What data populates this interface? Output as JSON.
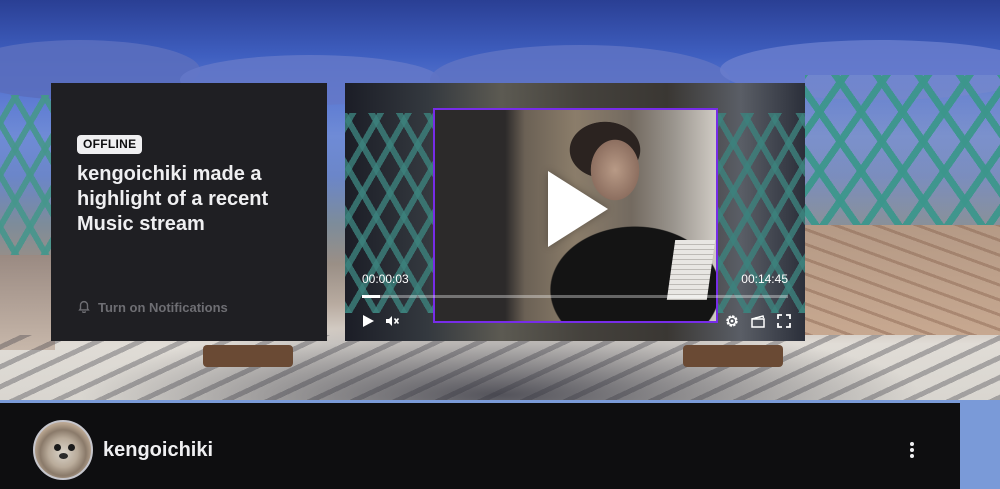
{
  "info_card": {
    "status_badge": "OFFLINE",
    "headline": "kengoichiki made a highlight of a recent Music stream",
    "notify_label": "Turn on Notifications",
    "notify_icon": "bell-icon"
  },
  "player": {
    "current_time": "00:00:03",
    "duration": "00:14:45",
    "progress_fraction": 0.01,
    "controls": {
      "play_icon": "play-icon",
      "mute_icon": "volume-muted-icon",
      "settings_icon": "gear-icon",
      "clip_icon": "clapperboard-icon",
      "fullscreen_icon": "fullscreen-icon"
    },
    "accent_color": "#772ce8"
  },
  "channel": {
    "name": "kengoichiki",
    "more_icon": "more-vertical-icon"
  }
}
